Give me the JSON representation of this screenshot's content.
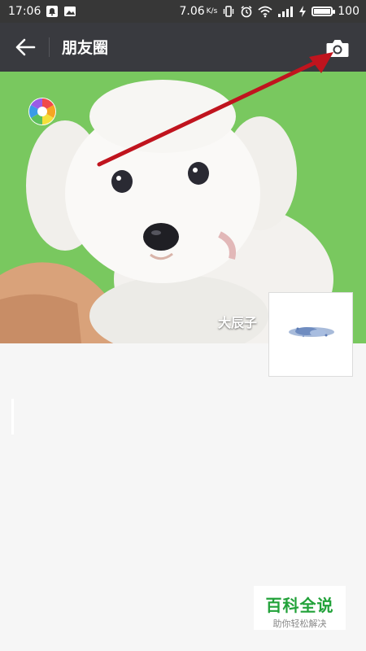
{
  "status_bar": {
    "time": "17:06",
    "speed": "7.06",
    "speed_unit": "K/s",
    "battery": "100",
    "battery_level": 1.0
  },
  "header": {
    "title": "朋友圈"
  },
  "profile": {
    "username": "大辰子"
  },
  "watermark": {
    "title": "百科全说",
    "subtitle": "助你轻松解决"
  },
  "colors": {
    "status_bar_bg": "#373737",
    "title_bar_bg": "#393a3f",
    "cover_bg": "#79c85f",
    "annotation_arrow": "#c0141e",
    "watermark_green": "#22a23a"
  },
  "icons": {
    "back": "arrow-left-icon",
    "camera": "camera-icon",
    "cover_badge": "aperture-icon"
  }
}
